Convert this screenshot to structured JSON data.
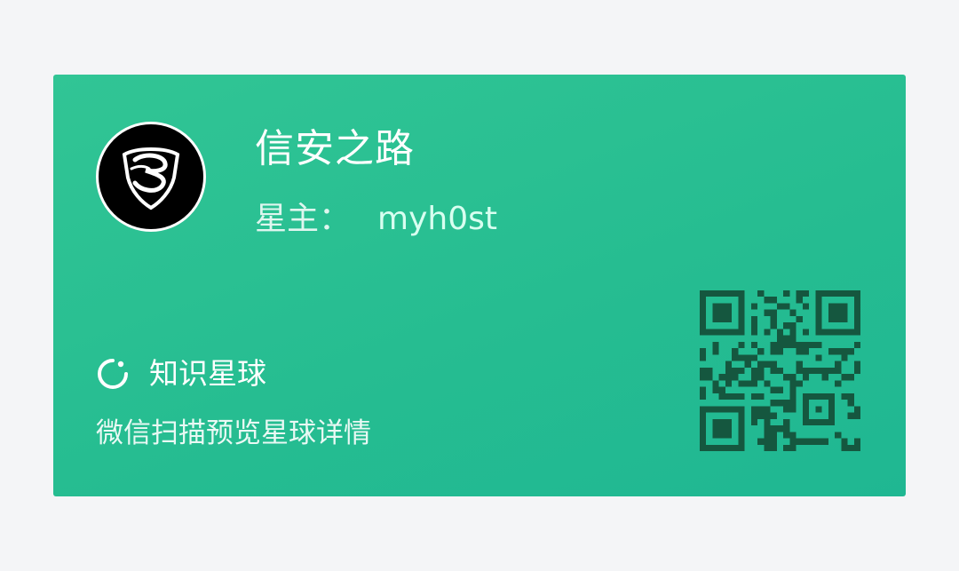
{
  "card": {
    "group_name": "信安之路",
    "owner_label": "星主：",
    "owner_name": "myh0st",
    "brand_name": "知识星球",
    "hint": "微信扫描预览星球详情",
    "avatar_icon": "shield-logo-icon",
    "brand_icon": "planet-ring-icon",
    "qr_icon": "qr-code-icon"
  },
  "colors": {
    "card_start": "#31c595",
    "card_end": "#1fb792",
    "qr_dark": "#15573f",
    "background": "#f4f5f7"
  }
}
